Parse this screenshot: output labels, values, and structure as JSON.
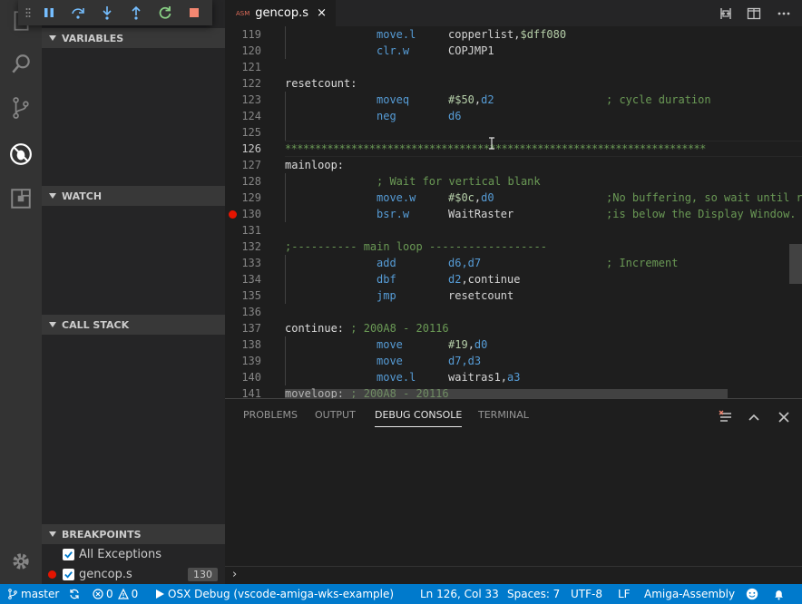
{
  "debug_toolbar": {
    "buttons": [
      "pause",
      "step-over",
      "step-into",
      "step-out",
      "restart",
      "stop"
    ]
  },
  "sidebar": {
    "sections": {
      "variables": "VARIABLES",
      "watch": "WATCH",
      "call_stack": "CALL STACK",
      "breakpoints": "BREAKPOINTS"
    },
    "breakpoints": [
      {
        "label": "All Exceptions",
        "checked": true
      },
      {
        "label": "gencop.s",
        "checked": true,
        "count": "130"
      }
    ]
  },
  "editor": {
    "tab": {
      "badge": "ASM",
      "filename": "gencop.s",
      "close": "×"
    },
    "lines": [
      {
        "n": "119",
        "op": "move.l",
        "arg": "copperlist,$dff080"
      },
      {
        "n": "120",
        "op": "clr.w",
        "arg": "COPJMP1"
      },
      {
        "n": "121"
      },
      {
        "n": "122",
        "label": "resetcount:"
      },
      {
        "n": "123",
        "op": "moveq",
        "arg": "#$50,d2",
        "comment": "; cycle duration"
      },
      {
        "n": "124",
        "op": "neg",
        "arg": "d6"
      },
      {
        "n": "125"
      },
      {
        "n": "126",
        "stars": "**********************************************************************"
      },
      {
        "n": "127",
        "label": "mainloop:"
      },
      {
        "n": "128",
        "inline_comment": "; Wait for vertical blank"
      },
      {
        "n": "129",
        "op": "move.w",
        "arg": "#$0c,d0",
        "comment": ";No buffering, so wait until r"
      },
      {
        "n": "130",
        "op": "bsr.w",
        "arg": "WaitRaster",
        "comment": ";is below the Display Window."
      },
      {
        "n": "131"
      },
      {
        "n": "132",
        "section": ";---------- main loop ------------------"
      },
      {
        "n": "133",
        "op": "add",
        "arg": "d6,d7",
        "comment": "; Increment"
      },
      {
        "n": "134",
        "op": "dbf",
        "arg": "d2,continue"
      },
      {
        "n": "135",
        "op": "jmp",
        "arg": "resetcount"
      },
      {
        "n": "136"
      },
      {
        "n": "137",
        "label": "continue:",
        "label_comment": "; 200A8 - 20116"
      },
      {
        "n": "138",
        "op": "move",
        "arg": "#19,d0"
      },
      {
        "n": "139",
        "op": "move",
        "arg": "d7,d3"
      },
      {
        "n": "140",
        "op": "move.l",
        "arg": "waitras1,a3"
      },
      {
        "n": "141",
        "label": "moveloop:",
        "label_comment": "; 200A8 - 20116"
      }
    ]
  },
  "panel": {
    "tabs": [
      "PROBLEMS",
      "OUTPUT",
      "DEBUG CONSOLE",
      "TERMINAL"
    ],
    "active_tab": "DEBUG CONSOLE",
    "prompt": "›"
  },
  "status": {
    "branch": "master",
    "errors": "0",
    "warnings": "0",
    "debug_config": "OSX Debug (vscode-amiga-wks-example)",
    "cursor": "Ln 126, Col 33",
    "spaces": "Spaces: 7",
    "encoding": "UTF-8",
    "eol": "LF",
    "language": "Amiga-Assembly"
  },
  "colors": {
    "status_bar": "#007acc",
    "breakpoint": "#e51400",
    "keyword": "#569cd6",
    "comment": "#6a9955"
  }
}
